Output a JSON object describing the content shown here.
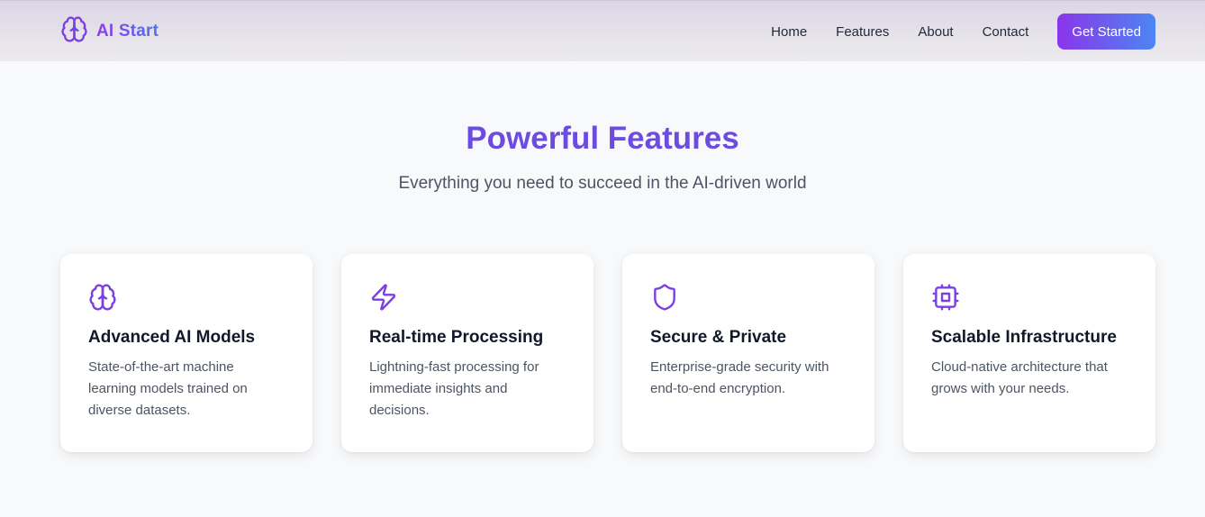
{
  "colors": {
    "accent_purple": "#7b3fe4",
    "accent_blue": "#4c86f3",
    "title_color": "#6d4be0",
    "background": "#f8f9fb"
  },
  "nav": {
    "brand_icon": "brain-icon",
    "brand": "AI Start",
    "links": [
      "Home",
      "Features",
      "About",
      "Contact"
    ],
    "cta": "Get Started"
  },
  "features": {
    "title": "Powerful Features",
    "subtitle": "Everything you need to succeed in the AI-driven world",
    "cards": [
      {
        "icon": "brain-icon",
        "title": "Advanced AI Models",
        "description": "State-of-the-art machine learning models trained on diverse datasets."
      },
      {
        "icon": "lightning-bolt-icon",
        "title": "Real-time Processing",
        "description": "Lightning-fast processing for immediate insights and decisions."
      },
      {
        "icon": "shield-icon",
        "title": "Secure & Private",
        "description": "Enterprise-grade security with end-to-end encryption."
      },
      {
        "icon": "cpu-chip-icon",
        "title": "Scalable Infrastructure",
        "description": "Cloud-native architecture that grows with your needs."
      }
    ]
  }
}
